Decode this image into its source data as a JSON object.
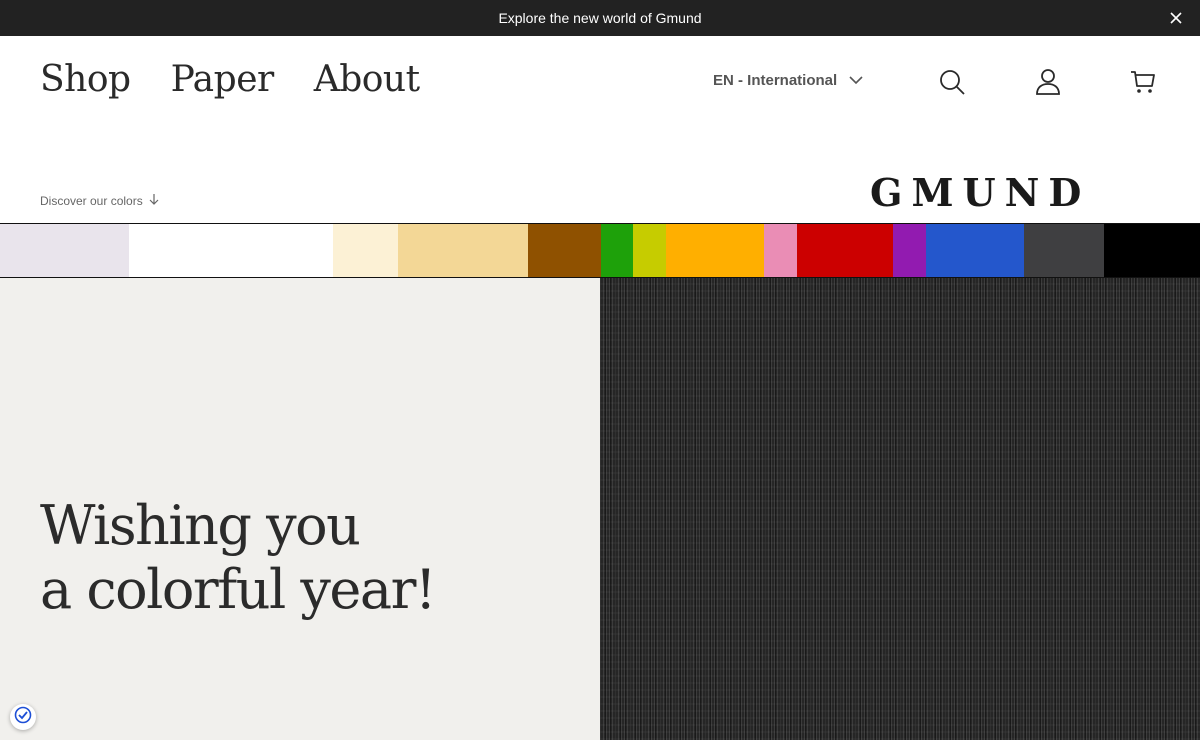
{
  "announcement": {
    "text": "Explore the new world of Gmund",
    "close_icon": "close-icon"
  },
  "nav": {
    "items": [
      {
        "label": "Shop"
      },
      {
        "label": "Paper"
      },
      {
        "label": "About"
      }
    ]
  },
  "header": {
    "language": "EN - International",
    "icons": [
      "search-icon",
      "user-icon",
      "cart-icon"
    ],
    "discover_label": "Discover our colors",
    "logo": "GMUND"
  },
  "colorbar": {
    "swatches": [
      {
        "color": "#e9e4ec",
        "weight": 129
      },
      {
        "color": "#ffffff",
        "weight": 204
      },
      {
        "color": "#fcf1d5",
        "weight": 65
      },
      {
        "color": "#f3d796",
        "weight": 130
      },
      {
        "color": "#8f5100",
        "weight": 73
      },
      {
        "color": "#1ea10a",
        "weight": 32
      },
      {
        "color": "#c6cc00",
        "weight": 33
      },
      {
        "color": "#ffaf00",
        "weight": 98
      },
      {
        "color": "#ea8db5",
        "weight": 33
      },
      {
        "color": "#cc0000",
        "weight": 96
      },
      {
        "color": "#921bb0",
        "weight": 33
      },
      {
        "color": "#2457cc",
        "weight": 98
      },
      {
        "color": "#3f3f41",
        "weight": 80
      },
      {
        "color": "#000000",
        "weight": 96
      }
    ]
  },
  "hero": {
    "line1": "Wishing you",
    "line2": "a colorful year!"
  },
  "colors": {
    "announcement_bg": "#222222",
    "hero_left_bg": "#f1f0ed",
    "hero_right_bg": "#262626"
  }
}
